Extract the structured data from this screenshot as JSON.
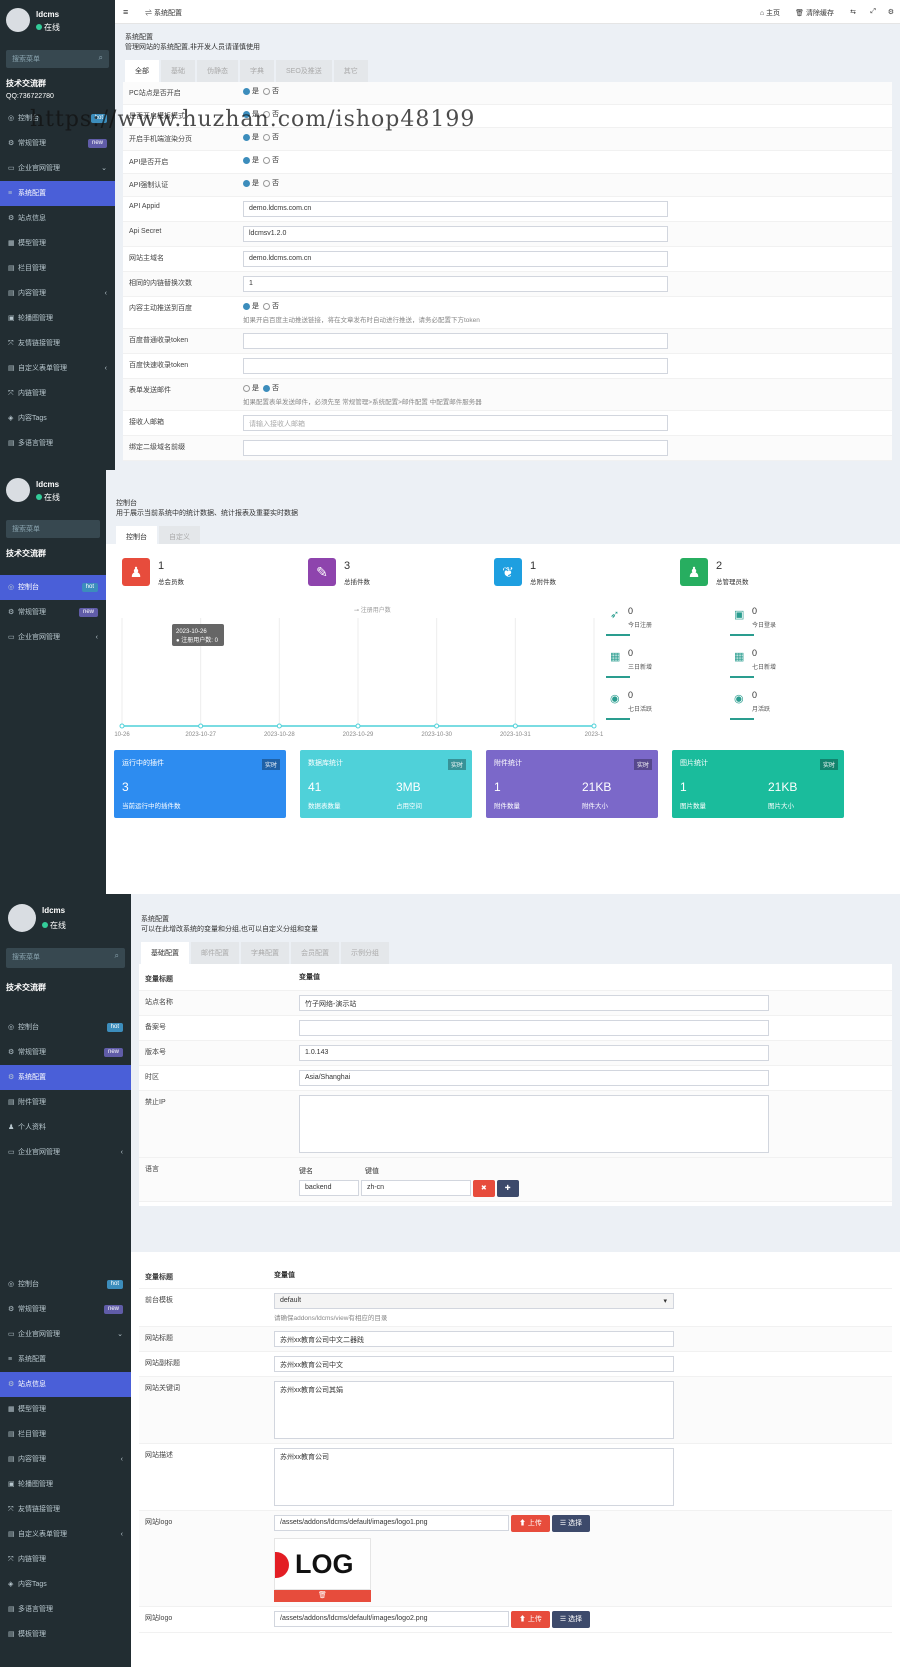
{
  "watermark": "https://www.huzhan.com/ishop48199",
  "p1": {
    "user": {
      "name": "ldcms",
      "status": "在线"
    },
    "search_placeholder": "搜索菜单",
    "group": "技术交流群",
    "qq": "QQ:736722780",
    "menu": [
      {
        "label": "控制台",
        "icon": "◎",
        "badge": "hot"
      },
      {
        "label": "常规管理",
        "icon": "⚙",
        "badge": "new"
      },
      {
        "label": "企业官网管理",
        "icon": "▭",
        "arrow": "⌄"
      },
      {
        "label": "系统配置",
        "icon": "≡",
        "active": true
      },
      {
        "label": "站点信息",
        "icon": "⚙"
      },
      {
        "label": "模型管理",
        "icon": "▦"
      },
      {
        "label": "栏目管理",
        "icon": "▤"
      },
      {
        "label": "内容管理",
        "icon": "▤",
        "arrow": "‹"
      },
      {
        "label": "轮播图管理",
        "icon": "▣"
      },
      {
        "label": "友情链接管理",
        "icon": "⤧"
      },
      {
        "label": "自定义表单管理",
        "icon": "▤",
        "arrow": "‹"
      },
      {
        "label": "内链管理",
        "icon": "⤧"
      },
      {
        "label": "内容Tags",
        "icon": "◈"
      },
      {
        "label": "多语言管理",
        "icon": "▤"
      }
    ],
    "topbar": {
      "menu_toggle": "≡",
      "crumb": "系统配置",
      "home": "主页",
      "clear_cache": "清除缓存"
    },
    "header_title": "系统配置",
    "header_desc": "管理网站的系统配置,非开发人员请谨慎使用",
    "tabs": [
      "全部",
      "基础",
      "伪静态",
      "字典",
      "SEO及推送",
      "其它"
    ],
    "rows": [
      {
        "label": "PC站点是否开启",
        "type": "radio",
        "yes": "是",
        "no": "否",
        "value": "yes"
      },
      {
        "label": "是否开启模板模式",
        "type": "radio",
        "yes": "是",
        "no": "否",
        "value": "yes"
      },
      {
        "label": "开启手机端渲染分页",
        "type": "radio",
        "yes": "是",
        "no": "否",
        "value": "yes"
      },
      {
        "label": "API是否开启",
        "type": "radio",
        "yes": "是",
        "no": "否",
        "value": "yes"
      },
      {
        "label": "API强制认证",
        "type": "radio",
        "yes": "是",
        "no": "否",
        "value": "yes"
      },
      {
        "label": "API Appid",
        "type": "input",
        "value": "demo.ldcms.com.cn"
      },
      {
        "label": "Api Secret",
        "type": "input",
        "value": "ldcmsv1.2.0"
      },
      {
        "label": "网站主域名",
        "type": "input",
        "value": "demo.ldcms.com.cn"
      },
      {
        "label": "相同的内链替换次数",
        "type": "input",
        "value": "1"
      },
      {
        "label": "内容主动推送到百度",
        "type": "radio",
        "yes": "是",
        "no": "否",
        "value": "yes",
        "help": "如果开启百度主动推送链接，将在文章发布时自动进行推送，请务必配置下方token"
      },
      {
        "label": "百度普通收录token",
        "type": "input",
        "value": ""
      },
      {
        "label": "百度快速收录token",
        "type": "input",
        "value": ""
      },
      {
        "label": "表单发送邮件",
        "type": "radio",
        "yes": "是",
        "no": "否",
        "value": "no",
        "help": "如果配置表单发送邮件，必须先至 常规管理>系统配置>邮件配置 中配置邮件服务器"
      },
      {
        "label": "接收人邮箱",
        "type": "input",
        "value": "",
        "placeholder": "请输入接收人邮箱"
      },
      {
        "label": "绑定二级域名前缀",
        "type": "input",
        "value": ""
      }
    ]
  },
  "p2": {
    "user": {
      "name": "ldcms",
      "status": "在线"
    },
    "search_placeholder": "搜索菜单",
    "group": "技术交流群",
    "menu": [
      {
        "label": "控制台",
        "icon": "◎",
        "badge": "hot",
        "active": true
      },
      {
        "label": "常规管理",
        "icon": "⚙",
        "badge": "new"
      },
      {
        "label": "企业官网管理",
        "icon": "▭",
        "arrow": "‹"
      }
    ],
    "header_title": "控制台",
    "header_desc": "用于展示当前系统中的统计数据、统计报表及重要实时数据",
    "tabs": [
      "控制台",
      "自定义"
    ],
    "stats": [
      {
        "num": "1",
        "label": "总会员数",
        "color": "#e74c3c",
        "icon": "♟"
      },
      {
        "num": "3",
        "label": "总插件数",
        "color": "#8e44ad",
        "icon": "✎"
      },
      {
        "num": "1",
        "label": "总附件数",
        "color": "#1e9fe0",
        "icon": "❦"
      },
      {
        "num": "2",
        "label": "总管理员数",
        "color": "#27ae60",
        "icon": "♟"
      }
    ],
    "chart_data": {
      "type": "line",
      "legend": [
        "注册用户数"
      ],
      "x": [
        "2023-10-26",
        "2023-10-27",
        "2023-10-28",
        "2023-10-29",
        "2023-10-30",
        "2023-10-31",
        "2023-11-01"
      ],
      "series": [
        {
          "name": "注册用户数",
          "values": [
            0,
            0,
            0,
            0,
            0,
            0,
            0
          ]
        }
      ],
      "tooltip": {
        "title": "2023-10-26",
        "text": "注册用户数: 0"
      },
      "x_tick_labels": [
        "10-26",
        "2023-10-27",
        "2023-10-28",
        "2023-10-29",
        "2023-10-30",
        "2023-10-31",
        "2023-1"
      ]
    },
    "minis": [
      {
        "num": "0",
        "label": "今日注册",
        "icon": "➶"
      },
      {
        "num": "0",
        "label": "今日登录",
        "icon": "▣"
      },
      {
        "num": "0",
        "label": "三日新增",
        "icon": "▦"
      },
      {
        "num": "0",
        "label": "七日新增",
        "icon": "▦"
      },
      {
        "num": "0",
        "label": "七日活跃",
        "icon": "◉"
      },
      {
        "num": "0",
        "label": "月活跃",
        "icon": "◉"
      }
    ],
    "cards": [
      {
        "title": "运行中的插件",
        "tag": "实时",
        "n1": "3",
        "s1": "当前运行中的插件数",
        "color": "#2d8cf0"
      },
      {
        "title": "数据库统计",
        "tag": "实时",
        "n1": "41",
        "s1": "数据表数量",
        "n2": "3MB",
        "s2": "占用空间",
        "color": "#4fd1d9"
      },
      {
        "title": "附件统计",
        "tag": "实时",
        "n1": "1",
        "s1": "附件数量",
        "n2": "21KB",
        "s2": "附件大小",
        "color": "#7b68c9"
      },
      {
        "title": "图片统计",
        "tag": "实时",
        "n1": "1",
        "s1": "图片数量",
        "n2": "21KB",
        "s2": "图片大小",
        "color": "#1abc9c"
      }
    ]
  },
  "p3": {
    "user": {
      "name": "ldcms",
      "status": "在线"
    },
    "search_placeholder": "搜索菜单",
    "group": "技术交流群",
    "menu": [
      {
        "label": "控制台",
        "icon": "◎",
        "badge": "hot"
      },
      {
        "label": "常规管理",
        "icon": "⚙",
        "badge": "new"
      },
      {
        "label": "系统配置",
        "icon": "⚙",
        "active": true
      },
      {
        "label": "附件管理",
        "icon": "▤"
      },
      {
        "label": "个人资料",
        "icon": "♟"
      },
      {
        "label": "企业官网管理",
        "icon": "▭",
        "arrow": "‹"
      }
    ],
    "header_title": "系统配置",
    "header_desc": "可以在此增改系统的变量和分组,也可以自定义分组和变量",
    "tabs": [
      "基础配置",
      "邮件配置",
      "字典配置",
      "会员配置",
      "示例分组"
    ],
    "col1": "变量标题",
    "col2": "变量值",
    "rows": [
      {
        "label": "站点名称",
        "value": "竹子网络-演示站"
      },
      {
        "label": "备案号",
        "value": ""
      },
      {
        "label": "版本号",
        "value": "1.0.143"
      },
      {
        "label": "时区",
        "value": "Asia/Shanghai"
      },
      {
        "label": "禁止IP",
        "value": "",
        "textarea": true
      }
    ],
    "lang_label": "语言",
    "key_hdr": "键名",
    "val_hdr": "键值",
    "lang_key": "backend",
    "lang_val": "zh-cn",
    "del": "✖",
    "add": "✚"
  },
  "p4": {
    "menu": [
      {
        "label": "控制台",
        "icon": "◎",
        "badge": "hot"
      },
      {
        "label": "常规管理",
        "icon": "⚙",
        "badge": "new"
      },
      {
        "label": "企业官网管理",
        "icon": "▭",
        "arrow": "⌄"
      },
      {
        "label": "系统配置",
        "icon": "≡"
      },
      {
        "label": "站点信息",
        "icon": "⚙",
        "active": true
      },
      {
        "label": "模型管理",
        "icon": "▦"
      },
      {
        "label": "栏目管理",
        "icon": "▤"
      },
      {
        "label": "内容管理",
        "icon": "▤",
        "arrow": "‹"
      },
      {
        "label": "轮播图管理",
        "icon": "▣"
      },
      {
        "label": "友情链接管理",
        "icon": "⤧"
      },
      {
        "label": "自定义表单管理",
        "icon": "▤",
        "arrow": "‹"
      },
      {
        "label": "内链管理",
        "icon": "⤧"
      },
      {
        "label": "内容Tags",
        "icon": "◈"
      },
      {
        "label": "多语言管理",
        "icon": "▤"
      },
      {
        "label": "模板管理",
        "icon": "▤"
      }
    ],
    "col1": "变量标题",
    "col2": "变量值",
    "template_label": "前台模板",
    "template_value": "default",
    "template_help": "请确保addons/ldcms/view有相应的目录",
    "title_label": "网站标题",
    "title_value": "苏州xx教育公司中文二器践",
    "subtitle_label": "网站副标题",
    "subtitle_value": "苏州xx教育公司中文",
    "kw_label": "网站关键词",
    "kw_value": "苏州xx教育公司其娟",
    "desc_label": "网站描述",
    "desc_value": "苏州xx教育公司",
    "logo_label": "网站logo",
    "logo_path": "/assets/addons/ldcms/default/images/logo1.png",
    "logo2_label": "网站logo",
    "logo2_path": "/assets/addons/ldcms/default/images/logo2.png",
    "upload": "上传",
    "choose": "选择",
    "logo_text": "LOG",
    "trash": "🗑"
  }
}
